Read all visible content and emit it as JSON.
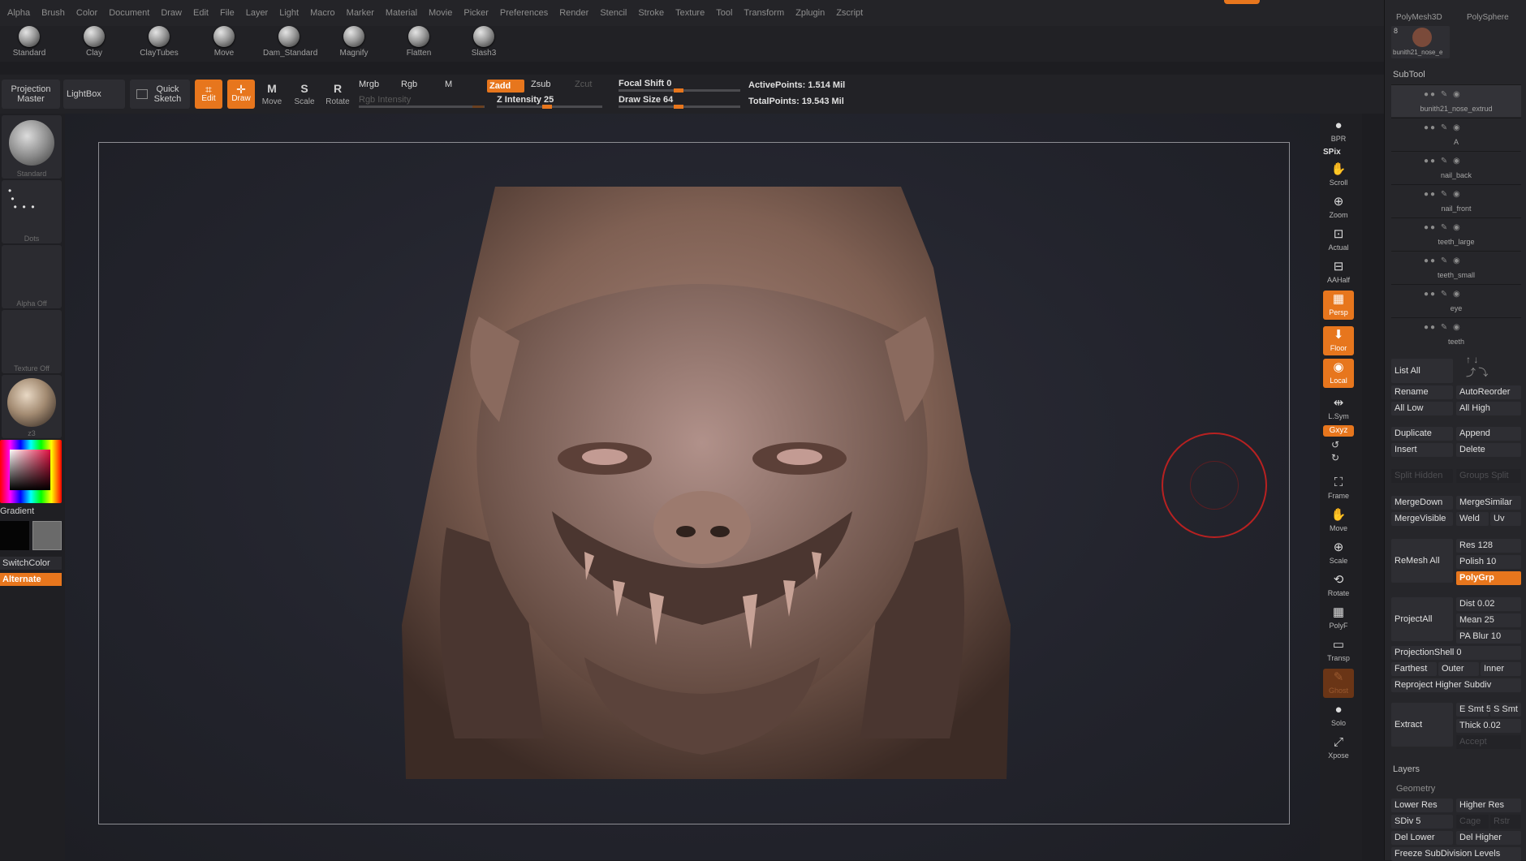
{
  "menubar": {
    "items": [
      "Alpha",
      "Brush",
      "Color",
      "Document",
      "Draw",
      "Edit",
      "File",
      "Layer",
      "Light",
      "Macro",
      "Marker",
      "Material",
      "Movie",
      "Picker",
      "Preferences",
      "Render",
      "Stencil",
      "Stroke",
      "Texture",
      "Tool",
      "Transform",
      "Zplugin",
      "Zscript"
    ]
  },
  "brushes": [
    "Standard",
    "Clay",
    "ClayTubes",
    "Move",
    "Dam_Standard",
    "Magnify",
    "Flatten",
    "Slash3"
  ],
  "toolbar": {
    "projection_master": "Projection Master",
    "lightbox": "LightBox",
    "quick_sketch": "Quick Sketch",
    "edit": "Edit",
    "draw": "Draw",
    "move": "Move",
    "scale": "Scale",
    "rotate": "Rotate",
    "mrgb": "Mrgb",
    "rgb": "Rgb",
    "m": "M",
    "zadd": "Zadd",
    "zsub": "Zsub",
    "zcut": "Zcut",
    "rgb_intensity": "Rgb Intensity",
    "z_intensity": "Z Intensity 25",
    "focal_shift": "Focal Shift 0",
    "draw_size": "Draw Size 64",
    "active_points": "ActivePoints: 1.514 Mil",
    "total_points": "TotalPoints: 19.543 Mil"
  },
  "lefttray": {
    "brush_label": "Standard",
    "stroke_label": "Dots",
    "alpha_label": "Alpha Off",
    "texture_label": "Texture Off",
    "material_label": "z3",
    "gradient": "Gradient",
    "switchcolor": "SwitchColor",
    "alternate": "Alternate"
  },
  "rightshelf": {
    "bpr": "BPR",
    "spix": "SPix",
    "scroll": "Scroll",
    "zoom": "Zoom",
    "actual": "Actual",
    "aahalf": "AAHalf",
    "persp": "Persp",
    "floor": "Floor",
    "local": "Local",
    "lsym": "L.Sym",
    "xyz": "Gxyz",
    "frame": "Frame",
    "move": "Move",
    "scale": "Scale",
    "rotate": "Rotate",
    "polyf": "PolyF",
    "transp": "Transp",
    "ghost": "Ghost",
    "solo": "Solo",
    "xpose": "Xpose"
  },
  "subtoolpanel": {
    "thumbs": [
      "PolyMesh3D",
      "PolySphere"
    ],
    "thumb_count": "8",
    "thumb_active": "bunith21_nose_e",
    "header": "SubTool",
    "subtools": [
      "bunith21_nose_extrud",
      "A",
      "nail_back",
      "nail_front",
      "teeth_large",
      "teeth_small",
      "eye",
      "teeth"
    ],
    "list_all": "List All",
    "rename": "Rename",
    "autoreorder": "AutoReorder",
    "all_low": "All Low",
    "all_high": "All High",
    "duplicate": "Duplicate",
    "append": "Append",
    "insert": "Insert",
    "delete": "Delete",
    "split_hidden": "Split Hidden",
    "groups_split": "Groups Split",
    "mergedown": "MergeDown",
    "mergesimilar": "MergeSimilar",
    "mergevisible": "MergeVisible",
    "weld": "Weld",
    "uv": "Uv",
    "remesh_all": "ReMesh All",
    "res": "Res 128",
    "polish": "Polish 10",
    "polygrp": "PolyGrp",
    "projectall": "ProjectAll",
    "dist": "Dist 0.02",
    "mean": "Mean 25",
    "pa_blur": "PA Blur 10",
    "projectionshell": "ProjectionShell 0",
    "farthest": "Farthest",
    "outer": "Outer",
    "inner": "Inner",
    "reproject": "Reproject Higher Subdiv",
    "extract": "Extract",
    "e_smt": "E Smt 5",
    "s_smt": "S Smt",
    "thick": "Thick 0.02",
    "accept": "Accept",
    "layers": "Layers",
    "geometry": "Geometry",
    "lower_res": "Lower Res",
    "higher_res": "Higher Res",
    "sdiv": "SDiv 5",
    "cage": "Cage",
    "rstr": "Rstr",
    "del_lower": "Del Lower",
    "del_higher": "Del Higher",
    "freeze": "Freeze SubDivision Levels"
  },
  "colors": {
    "accent": "#e7761d",
    "cursor": "#b82121",
    "clay": "#8a6a5c"
  }
}
